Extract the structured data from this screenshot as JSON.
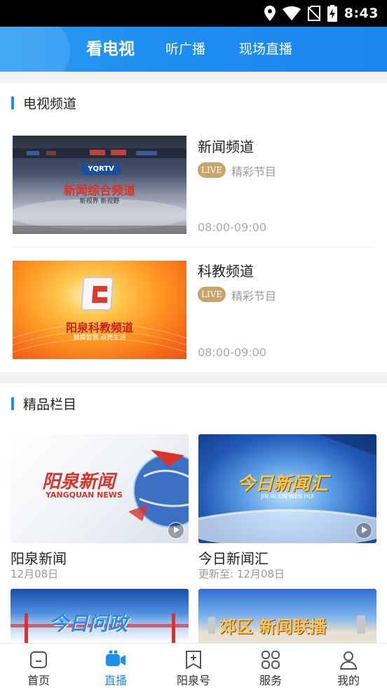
{
  "status_bar": {
    "time": "8:43"
  },
  "header": {
    "tabs": [
      {
        "label": "看电视",
        "active": true
      },
      {
        "label": "听广播",
        "active": false
      },
      {
        "label": "现场直播",
        "active": false
      }
    ]
  },
  "tv_section": {
    "title": "电视频道",
    "channels": [
      {
        "name": "新闻频道",
        "badge": "LIVE",
        "subtitle": "精彩节目",
        "time": "08:00-09:00",
        "thumb": {
          "logo": "YQRTV",
          "title": "新闻综合频道",
          "slogan": "新视界 新视野"
        }
      },
      {
        "name": "科教频道",
        "badge": "LIVE",
        "subtitle": "精彩节目",
        "time": "08:00-09:00",
        "thumb": {
          "title": "阳泉科教频道",
          "slogan": "触摸智慧 点亮生活"
        }
      }
    ]
  },
  "columns_section": {
    "title": "精品栏目",
    "items": [
      {
        "title": "阳泉新闻",
        "date": "12月08日",
        "thumb_title": "阳泉新闻",
        "thumb_sub": "YANGQUAN NEWS"
      },
      {
        "title": "今日新闻汇",
        "date": "更新至: 12月08日",
        "thumb_title": "今日新闻汇",
        "thumb_sub": "JIN RI XIN WEN HUI"
      },
      {
        "thumb_title": "今日问政"
      },
      {
        "thumb_title": "郊区 新闻联播"
      }
    ]
  },
  "bottom_nav": [
    {
      "label": "首页",
      "icon": "home-icon",
      "active": false
    },
    {
      "label": "直播",
      "icon": "live-camera-icon",
      "active": true
    },
    {
      "label": "阳泉号",
      "icon": "bookmark-plus-icon",
      "active": false
    },
    {
      "label": "服务",
      "icon": "grid-icon",
      "active": false
    },
    {
      "label": "我的",
      "icon": "profile-icon",
      "active": false
    }
  ],
  "colors": {
    "accent": "#1e8ef0",
    "live_badge": "#c8a46a",
    "header": "#1e8ef0"
  }
}
